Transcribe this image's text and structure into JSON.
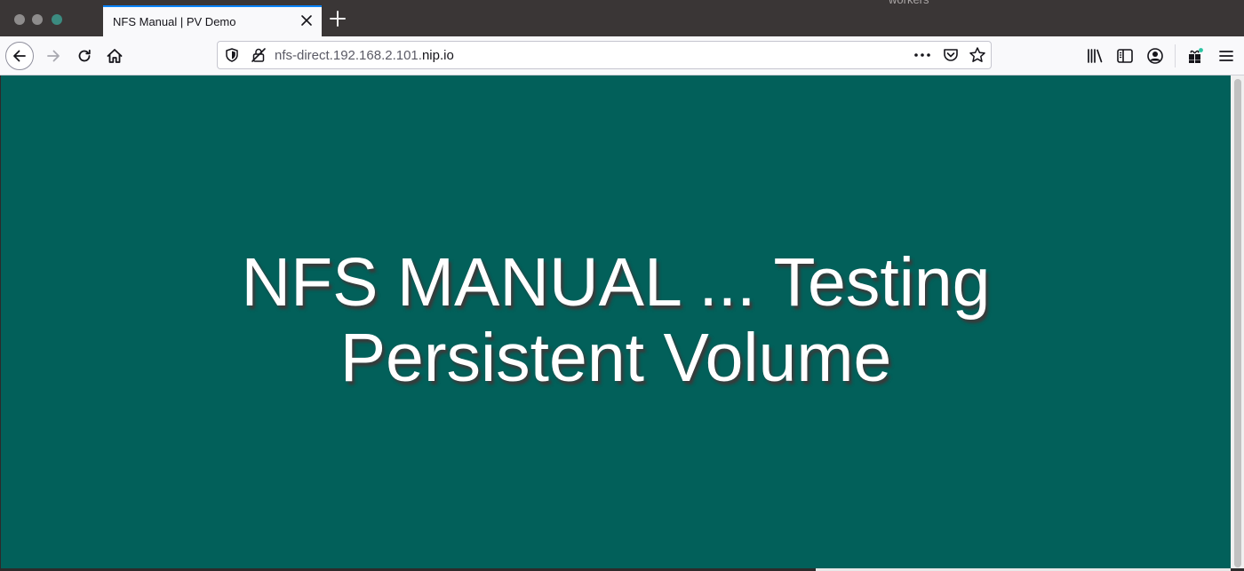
{
  "browser": {
    "tab": {
      "title": "NFS Manual | PV Demo"
    },
    "partial_top_text": "workers",
    "url": {
      "prefix": "nfs-direct.192.168.2.101.",
      "host": "nip.io"
    }
  },
  "page": {
    "background_color": "#02605a",
    "headline": "NFS MANUAL ... Testing Persistent Volume"
  },
  "icons": {
    "back": "back-arrow-icon",
    "forward": "forward-arrow-icon",
    "reload": "reload-icon",
    "home": "home-icon",
    "shield": "tracking-shield-icon",
    "insecure": "insecure-lock-icon",
    "more": "more-actions-icon",
    "pocket": "pocket-icon",
    "star": "bookmark-star-icon",
    "library": "library-icon",
    "sidebar": "sidebar-icon",
    "account": "account-icon",
    "extensions": "extensions-icon",
    "menu": "hamburger-menu-icon"
  }
}
